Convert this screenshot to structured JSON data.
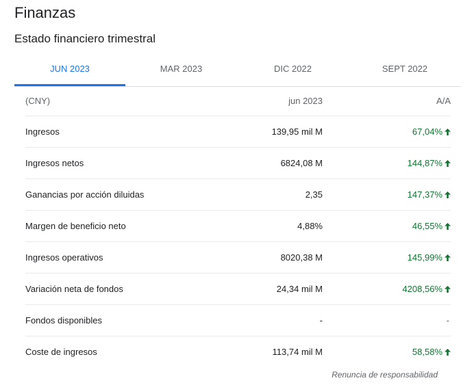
{
  "title": "Finanzas",
  "subtitle": "Estado financiero trimestral",
  "tabs": [
    {
      "label": "JUN 2023"
    },
    {
      "label": "MAR 2023"
    },
    {
      "label": "DIC 2022"
    },
    {
      "label": "SEPT 2022"
    }
  ],
  "table": {
    "header": {
      "currency": "(CNY)",
      "period": "jun 2023",
      "change": "A/A"
    },
    "rows": [
      {
        "label": "Ingresos",
        "value": "139,95 mil M",
        "change": "67,04%",
        "trend": "up"
      },
      {
        "label": "Ingresos netos",
        "value": "6824,08 M",
        "change": "144,87%",
        "trend": "up"
      },
      {
        "label": "Ganancias por acción diluidas",
        "value": "2,35",
        "change": "147,37%",
        "trend": "up"
      },
      {
        "label": "Margen de beneficio neto",
        "value": "4,88%",
        "change": "46,55%",
        "trend": "up"
      },
      {
        "label": "Ingresos operativos",
        "value": "8020,38 M",
        "change": "145,99%",
        "trend": "up"
      },
      {
        "label": "Variación neta de fondos",
        "value": "24,34 mil M",
        "change": "4208,56%",
        "trend": "up"
      },
      {
        "label": "Fondos disponibles",
        "value": "-",
        "change": "-",
        "trend": "none"
      },
      {
        "label": "Coste de ingresos",
        "value": "113,74 mil M",
        "change": "58,58%",
        "trend": "up"
      }
    ]
  },
  "disclaimer": "Renuncia de responsabilidad",
  "colors": {
    "accent": "#1a73e8",
    "positive": "#137333",
    "muted": "#5f6368"
  }
}
